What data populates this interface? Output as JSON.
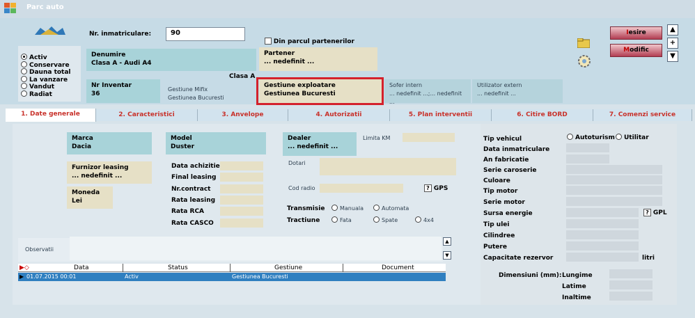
{
  "window": {
    "title": "Parc auto"
  },
  "header": {
    "nr_label": "Nr. inmatriculare:",
    "nr_value": "90",
    "din_parcul": "Din parcul partenerilor",
    "status_options": [
      "Activ",
      "Conservare",
      "Dauna total",
      "La vanzare",
      "Vandut",
      "Radiat"
    ],
    "denumire_label": "Denumire",
    "denumire_value": "Clasa A - Audi A4",
    "partener_label": "Partener",
    "partener_value": "... nedefinit ...",
    "clasa": "Clasa A",
    "inventar_label": "Nr Inventar",
    "inventar_value": "36",
    "gest_mifix_label": "Gestiune Mifix",
    "gest_mifix_value": "Gestiunea Bucuresti",
    "gest_expl_label": "Gestiune exploatare",
    "gest_expl_value": "Gestiunea Bucuresti",
    "sofer_label": "Sofer intern",
    "sofer_value": "... nedefinit ...;... nedefinit ...",
    "util_label": "Utilizator extern",
    "util_value": "... nedefinit ...",
    "iesire": "Iesire",
    "modific": "Modific",
    "plus": "+"
  },
  "tabs": [
    "1. Date generale",
    "2. Caracteristici",
    "3. Anvelope",
    "4. Autorizatii",
    "5. Plan interventii",
    "6. Citire BORD",
    "7. Comenzi service"
  ],
  "general": {
    "marca_label": "Marca",
    "marca_value": "Dacia",
    "model_label": "Model",
    "model_value": "Duster",
    "dealer_label": "Dealer",
    "dealer_value": "... nedefinit ...",
    "limita_km": "Limita KM",
    "furnizor_label": "Furnizor leasing",
    "furnizor_value": "... nedefinit ...",
    "data_achizitie": "Data achizitie",
    "final_leasing": "Final leasing",
    "nr_contract": "Nr.contract",
    "rata_leasing": "Rata leasing",
    "rata_rca": "Rata RCA",
    "rata_casco": "Rata CASCO",
    "dotari": "Dotari",
    "cod_radio": "Cod radio",
    "gps": "GPS",
    "q": "?",
    "moneda_label": "Moneda",
    "moneda_value": "Lei",
    "transmisie": "Transmisie",
    "manuala": "Manuala",
    "automata": "Automata",
    "tractiune": "Tractiune",
    "fata": "Fata",
    "spate": "Spate",
    "x4": "4x4",
    "observatii": "Observatii"
  },
  "grid": {
    "columns": [
      "Data",
      "Status",
      "Gestiune",
      "Document"
    ],
    "rows": [
      [
        "01.07.2015 00:01",
        "Activ",
        "Gestiunea Bucuresti",
        ""
      ]
    ]
  },
  "tech": {
    "tip_vehicul": "Tip vehicul",
    "autoturism": "Autoturism",
    "utilitar": "Utilitar",
    "labels": [
      "Data inmatriculare",
      "An fabricatie",
      "Serie caroserie",
      "Culoare",
      "Tip motor",
      "Serie motor",
      "Sursa energie",
      "Tip ulei",
      "Cilindree",
      "Putere",
      "Capacitate rezervor"
    ],
    "gpl": "GPL",
    "litri": "litri",
    "dimensiuni": "Dimensiuni (mm):",
    "lungime": "Lungime",
    "latime": "Latime",
    "inaltime": "Inaltime"
  }
}
